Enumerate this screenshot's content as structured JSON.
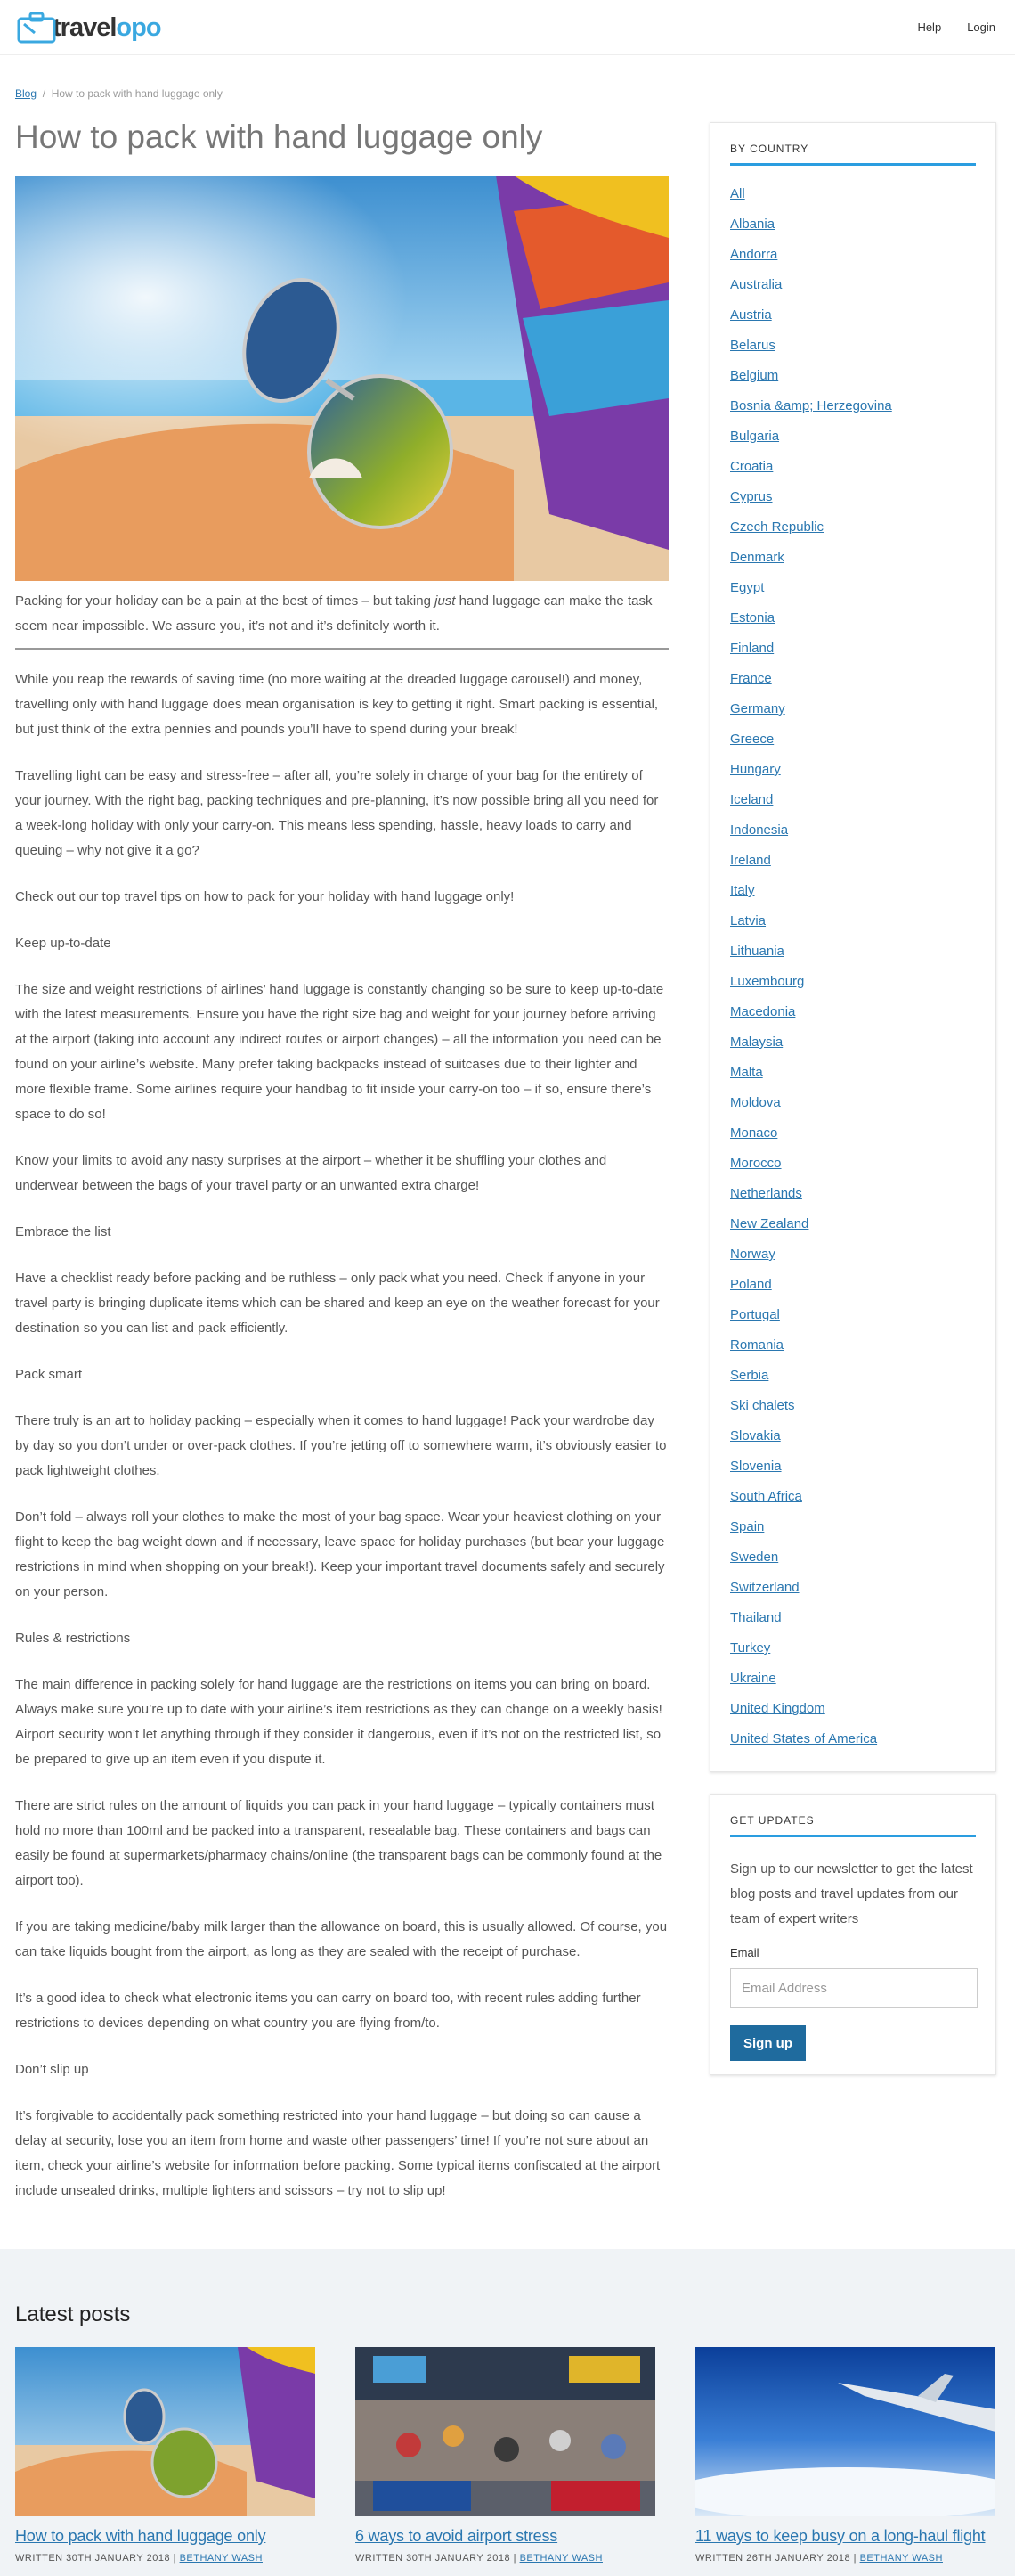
{
  "brand": {
    "logo_a": "travel",
    "logo_b": "opo"
  },
  "nav": {
    "help": "Help",
    "login": "Login"
  },
  "breadcrumb": {
    "blog": "Blog",
    "separator": "/",
    "current": "How to pack with hand luggage only"
  },
  "page_title": "How to pack with hand luggage only",
  "article": {
    "intro_1": "Packing for your holiday can be a pain at the best of times – but taking ",
    "intro_em": "just",
    "intro_2": " hand luggage can make the task seem near impossible. We assure you, it’s not and it’s definitely worth it.",
    "p1": "While you reap the rewards of saving time (no more waiting at the dreaded luggage carousel!) and money, travelling only with hand luggage does mean organisation is key to getting it right. Smart packing is essential, but just think of the extra pennies and pounds you’ll have to spend during your break!",
    "p2": "Travelling light can be easy and stress-free – after all, you’re solely in charge of your bag for the entirety of your journey. With the right bag, packing techniques and pre-planning, it’s now possible bring all you need for a week-long holiday with only your carry-on. This means less spending, hassle, heavy loads to carry and queuing – why not give it a go?",
    "p3": "Check out our top travel tips on how to pack for your holiday with hand luggage only!",
    "h1": "Keep up-to-date",
    "p4": "The size and weight restrictions of airlines’ hand luggage is constantly changing so be sure to keep up-to-date with the latest measurements. Ensure you have the right size bag and weight for your journey before arriving at the airport (taking into account any indirect routes or airport changes) – all the information you need can be found on your airline’s website. Many prefer taking backpacks instead of suitcases due to their lighter and more flexible frame. Some airlines require your handbag to fit inside your carry-on too – if so, ensure there’s space to do so!",
    "p5": "Know your limits to avoid any nasty surprises at the airport – whether it be shuffling your clothes and underwear between the bags of your travel party or an unwanted extra charge!",
    "h2": "Embrace the list",
    "p6": "Have a checklist ready before packing and be ruthless – only pack what you need. Check if anyone in your travel party is bringing duplicate items which can be shared and keep an eye on the weather forecast for your destination so you can list and pack efficiently.",
    "h3": "Pack smart",
    "p7": "There truly is an art to holiday packing – especially when it comes to hand luggage! Pack your wardrobe day by day so you don’t under or over-pack clothes. If you’re jetting off to somewhere warm, it’s obviously easier to pack lightweight clothes.",
    "p8": "Don’t fold – always roll your clothes to make the most of your bag space. Wear your heaviest clothing on your flight to keep the bag weight down and if necessary, leave space for holiday purchases (but bear your luggage restrictions in mind when shopping on your break!). Keep your important travel documents safely and securely on your person.",
    "h4": "Rules & restrictions",
    "p9": "The main difference in packing solely for hand luggage are the restrictions on items you can bring on board. Always make sure you’re up to date with your airline’s item restrictions as they can change on a weekly basis! Airport security won’t let anything through if they consider it dangerous, even if it’s not on the restricted list, so be prepared to give up an item even if you dispute it.",
    "p10": "There are strict rules on the amount of liquids you can pack in your hand luggage – typically containers must hold no more than 100ml and be packed into a transparent, resealable bag. These containers and bags can easily be found at supermarkets/pharmacy chains/online (the transparent bags can be commonly found at the airport too).",
    "p11": "If you are taking medicine/baby milk larger than the allowance on board, this is usually allowed. Of course, you can take liquids bought from the airport, as long as they are sealed with the receipt of purchase.",
    "p12": "It’s a good idea to check what electronic items you can carry on board too, with recent rules adding further restrictions to devices depending on what country you are flying from/to.",
    "h5": "Don’t slip up",
    "p13": "It’s forgivable to accidentally pack something restricted into your hand luggage – but doing so can cause a delay at security, lose you an item from home and waste other passengers’ time! If you’re not sure about an item, check your airline’s website for information before packing. Some typical items confiscated at the airport include unsealed drinks, multiple lighters and scissors – try not to slip up!"
  },
  "sidebar": {
    "heading": "BY COUNTRY",
    "countries": [
      "All",
      "Albania",
      "Andorra",
      "Australia",
      "Austria",
      "Belarus",
      "Belgium",
      "Bosnia &amp; Herzegovina",
      "Bulgaria",
      "Croatia",
      "Cyprus",
      "Czech Republic",
      "Denmark",
      "Egypt",
      "Estonia",
      "Finland",
      "France",
      "Germany",
      "Greece",
      "Hungary",
      "Iceland",
      "Indonesia",
      "Ireland",
      "Italy",
      "Latvia",
      "Lithuania",
      "Luxembourg",
      "Macedonia",
      "Malaysia",
      "Malta",
      "Moldova",
      "Monaco",
      "Morocco",
      "Netherlands",
      "New Zealand",
      "Norway",
      "Poland",
      "Portugal",
      "Romania",
      "Serbia",
      "Ski chalets",
      "Slovakia",
      "Slovenia",
      "South Africa",
      "Spain",
      "Sweden",
      "Switzerland",
      "Thailand",
      "Turkey",
      "Ukraine",
      "United Kingdom",
      "United States of America"
    ]
  },
  "updates": {
    "heading": "GET UPDATES",
    "description": "Sign up to our newsletter to get the latest blog posts and travel updates from our team of expert writers",
    "email_label": "Email",
    "email_placeholder": "Email Address",
    "signup": "Sign up"
  },
  "latest": {
    "heading": "Latest posts",
    "posts": [
      {
        "title": "How to pack with hand luggage only",
        "written": "WRITTEN 30TH JANUARY 2018 |",
        "author": "BETHANY WASH"
      },
      {
        "title": "6 ways to avoid airport stress",
        "written": "WRITTEN 30TH JANUARY 2018 |",
        "author": "BETHANY WASH"
      },
      {
        "title": "11 ways to keep busy on a long-haul flight",
        "written": "WRITTEN 26TH JANUARY 2018 |",
        "author": "BETHANY WASH"
      }
    ]
  },
  "colors": {
    "accent": "#2a9de0",
    "link": "#2a77b0",
    "button": "#1f6b9e",
    "footer_bg": "#f0f3f6"
  }
}
